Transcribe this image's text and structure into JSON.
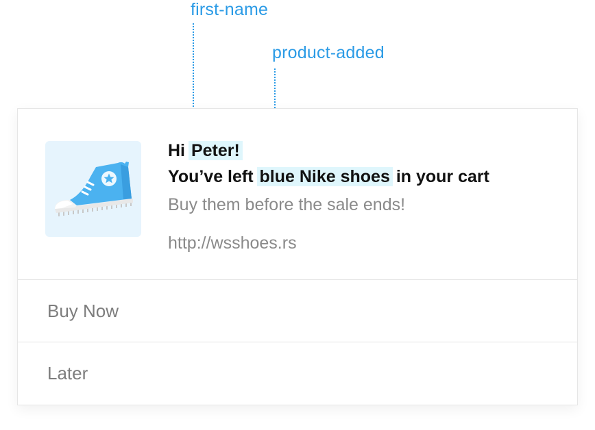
{
  "annotations": {
    "first_name": "first-name",
    "product_added": "product-added",
    "color": "#2b9be6"
  },
  "notification": {
    "image": "blue-sneaker-icon",
    "greeting_prefix": "Hi ",
    "first_name": "Peter!",
    "message_prefix": "You’ve left ",
    "product": "blue Nike shoes",
    "message_suffix": " in your cart",
    "subtitle": "Buy them before the sale ends!",
    "url": "http://wsshoes.rs",
    "highlight_color": "#dff6fc"
  },
  "actions": {
    "buy_now": "Buy Now",
    "later": "Later"
  }
}
